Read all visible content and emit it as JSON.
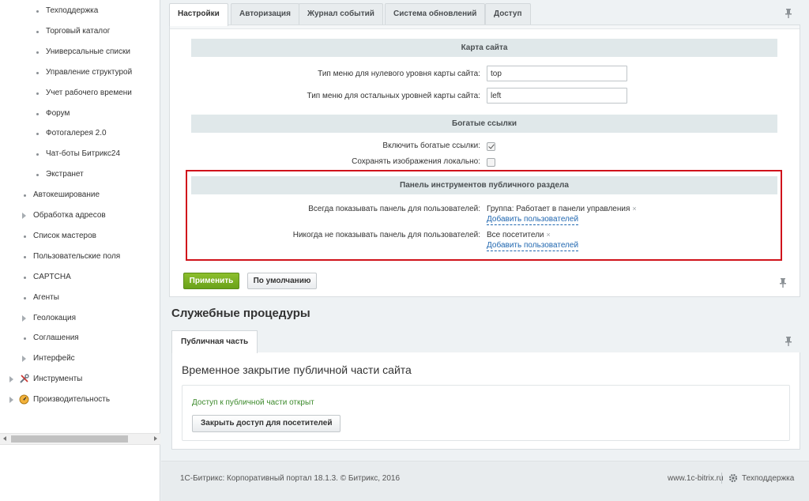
{
  "sidebar": {
    "items": [
      {
        "label": "Техподдержка",
        "level": 2,
        "marker": "dot"
      },
      {
        "label": "Торговый каталог",
        "level": 2,
        "marker": "dot"
      },
      {
        "label": "Универсальные списки",
        "level": 2,
        "marker": "dot"
      },
      {
        "label": "Управление структурой",
        "level": 2,
        "marker": "dot"
      },
      {
        "label": "Учет рабочего времени",
        "level": 2,
        "marker": "dot"
      },
      {
        "label": "Форум",
        "level": 2,
        "marker": "dot"
      },
      {
        "label": "Фотогалерея 2.0",
        "level": 2,
        "marker": "dot"
      },
      {
        "label": "Чат-боты Битрикс24",
        "level": 2,
        "marker": "dot"
      },
      {
        "label": "Экстранет",
        "level": 2,
        "marker": "dot"
      },
      {
        "label": "Автокеширование",
        "level": 1,
        "marker": "dot"
      },
      {
        "label": "Обработка адресов",
        "level": 1,
        "marker": "arrow"
      },
      {
        "label": "Список мастеров",
        "level": 1,
        "marker": "dot"
      },
      {
        "label": "Пользовательские поля",
        "level": 1,
        "marker": "dot"
      },
      {
        "label": "CAPTCHA",
        "level": 1,
        "marker": "dot"
      },
      {
        "label": "Агенты",
        "level": 1,
        "marker": "dot"
      },
      {
        "label": "Геолокация",
        "level": 1,
        "marker": "arrow"
      },
      {
        "label": "Соглашения",
        "level": 1,
        "marker": "dot"
      },
      {
        "label": "Интерфейс",
        "level": 1,
        "marker": "arrow"
      },
      {
        "label": "Инструменты",
        "level": 0,
        "marker": "arrow",
        "icon": "tools-icon"
      },
      {
        "label": "Производительность",
        "level": 0,
        "marker": "arrow",
        "icon": "gauge-icon"
      }
    ]
  },
  "settings_tabs": {
    "tabs": [
      "Настройки",
      "Авторизация",
      "Журнал событий",
      "Система обновлений",
      "Доступ"
    ],
    "active": "Настройки"
  },
  "sitemap": {
    "header": "Карта сайта",
    "top_menu_label": "Тип меню для нулевого уровня карты сайта:",
    "top_menu_value": "top",
    "other_menu_label": "Тип меню для остальных уровней карты сайта:",
    "other_menu_value": "left"
  },
  "rich_links": {
    "header": "Богатые ссылки",
    "enable_label": "Включить богатые ссылки:",
    "enable_checked": true,
    "save_images_label": "Сохранять изображения локально:",
    "save_images_checked": false
  },
  "public_panel": {
    "header": "Панель инструментов публичного раздела",
    "always_label": "Всегда показывать панель для пользователей:",
    "always_value": "Группа: Работает в панели управления",
    "always_add": "Добавить пользователей",
    "never_label": "Никогда не показывать панель для пользователей:",
    "never_value": "Все посетители",
    "never_add": "Добавить пользователей",
    "remove_glyph": "×"
  },
  "actions": {
    "apply": "Применить",
    "default": "По умолчанию"
  },
  "service": {
    "title": "Служебные процедуры",
    "tab": "Публичная часть",
    "panel_title": "Временное закрытие публичной части сайта",
    "status": "Доступ к публичной части открыт",
    "close_button": "Закрыть доступ для посетителей"
  },
  "footer": {
    "copyright": "1С-Битрикс: Корпоративный портал 18.1.3. © Битрикс, 2016",
    "site": "www.1c-bitrix.ru",
    "support": "Техподдержка"
  },
  "colors": {
    "highlight": "#d0131b",
    "apply_button": "#78ad22",
    "link": "#2067b0",
    "status_ok": "#3d8a2c"
  }
}
